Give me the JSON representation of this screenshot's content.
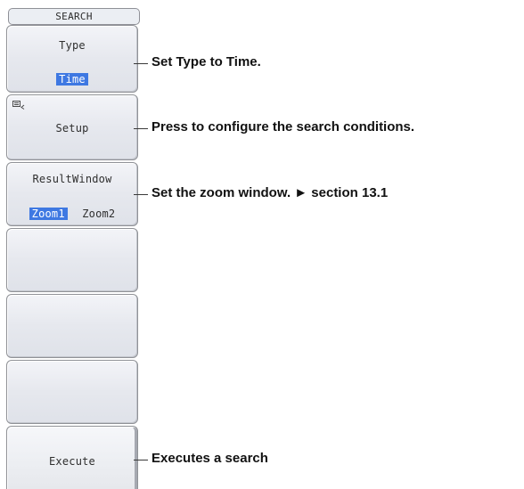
{
  "panel": {
    "header": "SEARCH",
    "type": {
      "label": "Type",
      "value": "Time"
    },
    "setup": {
      "label": "Setup",
      "icon": "menu-icon"
    },
    "result_window": {
      "label": "ResultWindow",
      "options": [
        "Zoom1",
        "Zoom2"
      ],
      "selected": "Zoom1"
    },
    "execute": {
      "label": "Execute"
    }
  },
  "callouts": {
    "type": "Set Type to Time.",
    "setup": "Press to configure the search conditions.",
    "result_window": "Set the zoom window. ► section 13.1",
    "execute": "Executes a search"
  }
}
